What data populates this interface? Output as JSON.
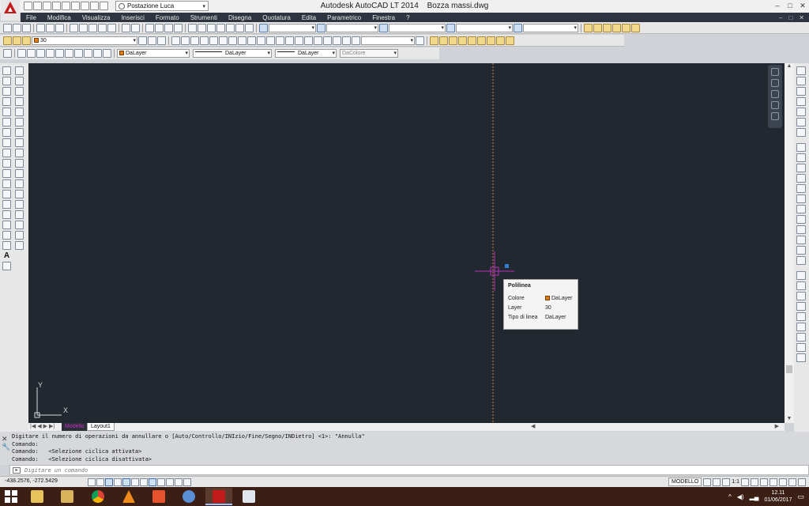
{
  "window": {
    "app_name": "Autodesk AutoCAD LT 2014",
    "file_name": "Bozza massi.dwg",
    "workspace": "Postazione Luca",
    "controls": [
      "–",
      "□",
      "✕"
    ]
  },
  "menu": {
    "items": [
      "File",
      "Modifica",
      "Visualizza",
      "Inserisci",
      "Formato",
      "Strumenti",
      "Disegna",
      "Quotatura",
      "Edita",
      "Parametrico",
      "Finestra",
      "?"
    ],
    "window_buttons": [
      "–",
      "□",
      "✕"
    ]
  },
  "properties": {
    "layer_current": "30",
    "color": "DaLayer",
    "linetype": "DaLayer",
    "lineweight": "DaLayer",
    "plotstyle": "DaColore"
  },
  "tooltip": {
    "title": "Polilinea",
    "rows": [
      {
        "key": "Colore",
        "value": "DaLayer"
      },
      {
        "key": "Layer",
        "value": "30"
      },
      {
        "key": "Tipo di linea",
        "value": "DaLayer"
      }
    ]
  },
  "ucs": {
    "x": "X",
    "y": "Y"
  },
  "layout_tabs": {
    "model": "Modello",
    "layout1": "Layout1"
  },
  "command": {
    "history": [
      "Digitare il numero di operazioni da annullare o [Auto/Controllo/INIzio/Fine/Segno/INDietro] <1>: \"Annulla\"",
      "Comando:",
      "Comando:   <Selezione ciclica attivata>",
      "Comando:   <Selezione ciclica disattivata>"
    ],
    "placeholder": "Digitare un comando"
  },
  "status": {
    "coords": "-438.2576, -272.5429",
    "space": "MODELLO",
    "scale": "1:1"
  },
  "taskbar": {
    "time": "12.11",
    "date": "01/06/2017"
  },
  "colors": {
    "canvas": "#212830",
    "crosshair": "#b531b5",
    "snap_line": "#c8852a",
    "layer_swatch": "#e07b1a",
    "menubar": "#2e3440",
    "taskbar": "#3b1f14"
  },
  "icons": {
    "app": "autocad-logo-icon",
    "start": "windows-start-icon",
    "taskbar_apps": [
      "file-explorer-icon",
      "file-manager-icon",
      "chrome-icon",
      "vlc-icon",
      "video-player-icon",
      "system-utility-icon",
      "autocad-icon",
      "document-icon"
    ]
  }
}
